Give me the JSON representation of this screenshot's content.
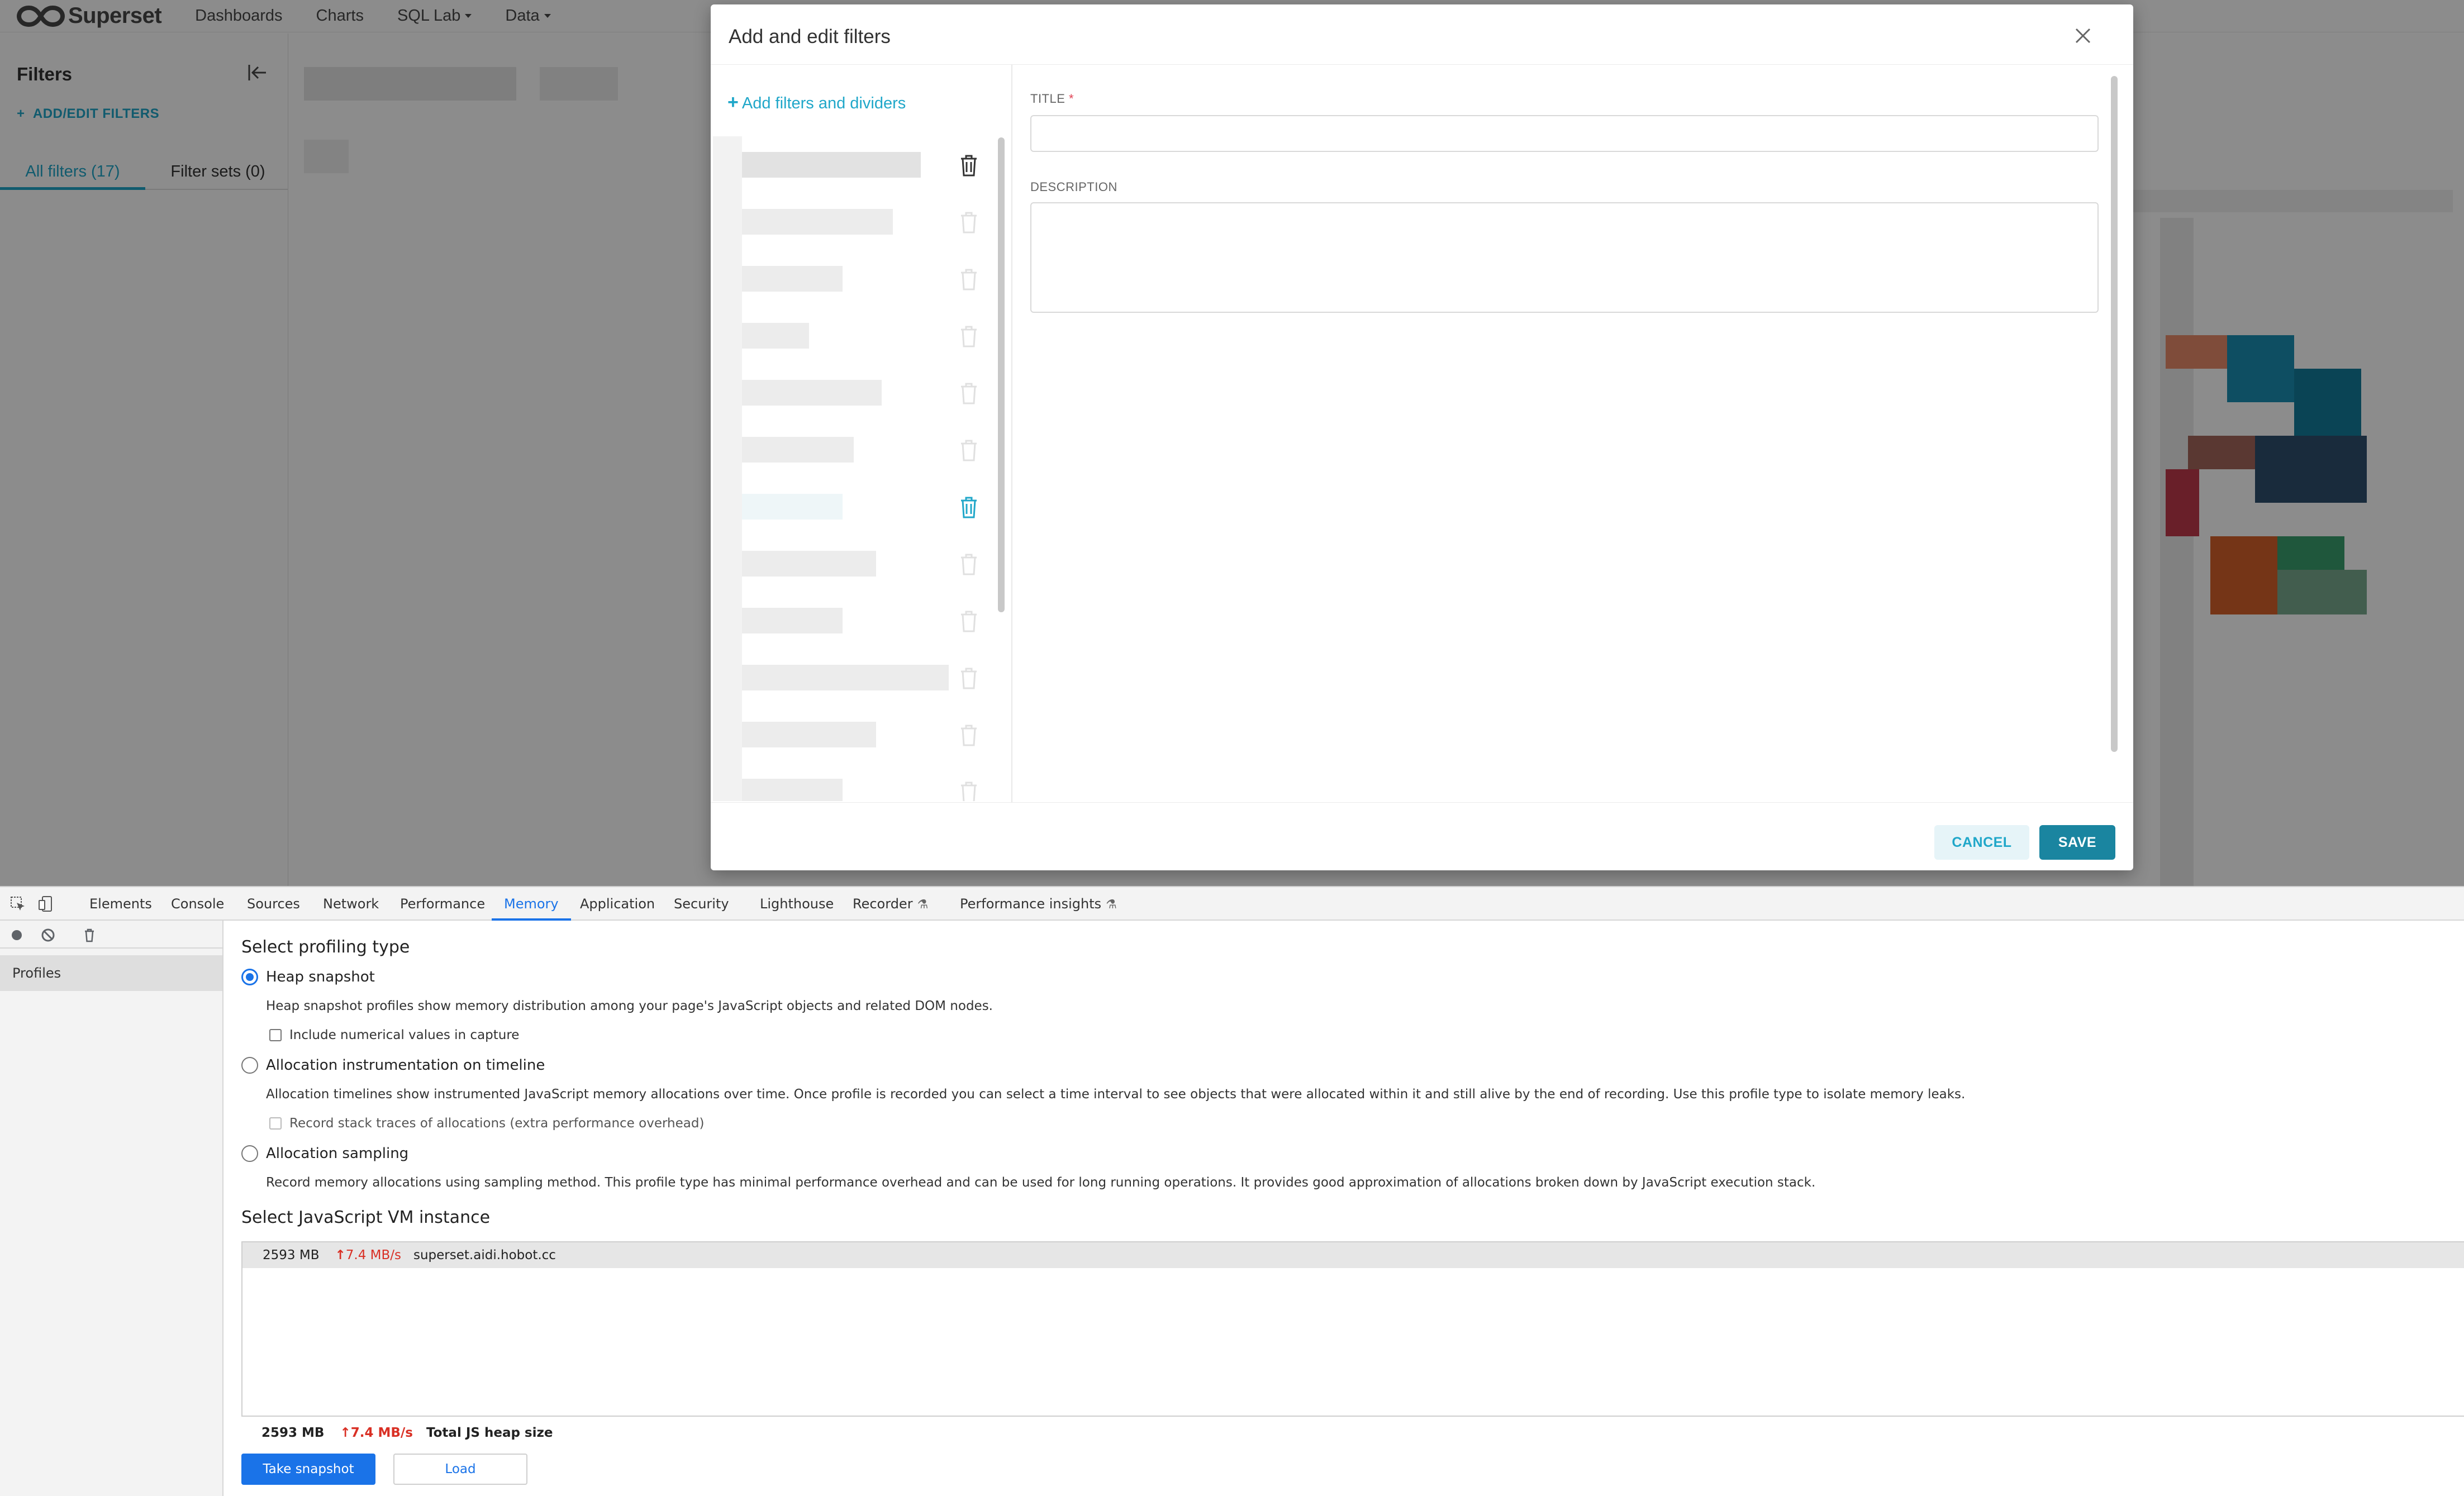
{
  "app": {
    "logo_text": "Superset",
    "nav": [
      {
        "label": "Dashboards"
      },
      {
        "label": "Charts"
      },
      {
        "label": "SQL Lab"
      },
      {
        "label": "Data"
      }
    ]
  },
  "filter_panel": {
    "title": "Filters",
    "add_edit_label": "ADD/EDIT FILTERS",
    "tabs": [
      {
        "label": "All filters (17)",
        "active": true
      },
      {
        "label": "Filter sets (0)",
        "active": false
      }
    ]
  },
  "modal": {
    "title": "Add and edit filters",
    "add_filters_label": "Add filters and dividers",
    "title_field_label": "TITLE",
    "title_field_required": "*",
    "title_field_value": "",
    "description_label": "DESCRIPTION",
    "description_value": "",
    "cancel_label": "CANCEL",
    "save_label": "SAVE"
  },
  "devtools": {
    "tabs": [
      {
        "label": "Elements"
      },
      {
        "label": "Console"
      },
      {
        "label": "Sources"
      },
      {
        "label": "Network"
      },
      {
        "label": "Performance"
      },
      {
        "label": "Memory",
        "active": true
      },
      {
        "label": "Application"
      },
      {
        "label": "Security"
      },
      {
        "label": "Lighthouse"
      },
      {
        "label": "Recorder"
      },
      {
        "label": "Performance insights"
      }
    ],
    "sidebar_item": "Profiles",
    "profiling_title": "Select profiling type",
    "options": [
      {
        "label": "Heap snapshot",
        "checked": true,
        "description": "Heap snapshot profiles show memory distribution among your page's JavaScript objects and related DOM nodes.",
        "checkbox": "Include numerical values in capture"
      },
      {
        "label": "Allocation instrumentation on timeline",
        "checked": false,
        "description": "Allocation timelines show instrumented JavaScript memory allocations over time. Once profile is recorded you can select a time interval to see objects that were allocated within it and still alive by the end of recording. Use this profile type to isolate memory leaks.",
        "checkbox": "Record stack traces of allocations (extra performance overhead)"
      },
      {
        "label": "Allocation sampling",
        "checked": false,
        "description": "Record memory allocations using sampling method. This profile type has minimal performance overhead and can be used for long running operations. It provides good approximation of allocations broken down by JavaScript execution stack."
      }
    ],
    "vm_title": "Select JavaScript VM instance",
    "vm_instance": {
      "memory": "2593 MB",
      "rate": "7.4 MB/s",
      "host": "superset.aidi.hobot.cc"
    },
    "totals": {
      "memory": "2593 MB",
      "rate": "7.4 MB/s",
      "label": "Total JS heap size"
    },
    "take_snapshot_label": "Take snapshot",
    "load_label": "Load"
  },
  "colors": {
    "superset_accent": "#20a7c9",
    "save_button": "#1a85a0",
    "devtools_blue": "#1a73e8",
    "rate_red": "#d93025"
  }
}
